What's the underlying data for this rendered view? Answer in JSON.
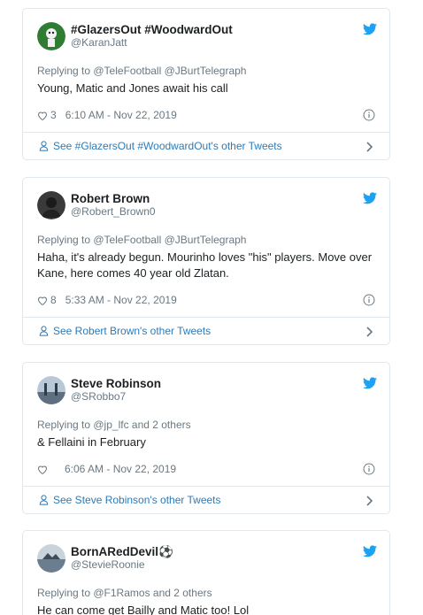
{
  "tweets": [
    {
      "name": "#GlazersOut #WoodwardOut",
      "handle": "@KaranJatt",
      "reply": "Replying to @TeleFootball @JBurtTelegraph",
      "text": "Young, Matic and Jones await his call",
      "likes": "3",
      "time": "6:10 AM - Nov 22, 2019",
      "see": "See #GlazersOut #WoodwardOut's other Tweets",
      "avatar_color": "#2e7d32"
    },
    {
      "name": "Robert Brown",
      "handle": "@Robert_Brown0",
      "reply": "Replying to @TeleFootball @JBurtTelegraph",
      "text": "Haha, it's already begun. Mourinho loves \"his\" players. Move over Kane, here comes 40 year old Zlatan.",
      "likes": "8",
      "time": "5:33 AM - Nov 22, 2019",
      "see": "See Robert Brown's other Tweets",
      "avatar_color": "#3a3a3a"
    },
    {
      "name": "Steve Robinson",
      "handle": "@SRobbo7",
      "reply": "Replying to @jp_lfc and 2 others",
      "text": "& Fellaini in February",
      "likes": "",
      "time": "6:06 AM - Nov 22, 2019",
      "see": "See Steve Robinson's other Tweets",
      "avatar_color": "#8aa2b8"
    },
    {
      "name": "BornARedDevil⚽",
      "handle": "@StevieRoonie",
      "reply": "Replying to @F1Ramos and 2 others",
      "text": "He can come get Bailly and Matic too! Lol",
      "avatar_color": "#6b7d8f"
    }
  ],
  "colors": {
    "link": "#2b7bb9",
    "twitter": "#1da1f2",
    "muted": "#697882",
    "border": "#e1e8ed"
  },
  "icons": [
    "twitter-bird-icon",
    "heart-icon",
    "info-icon",
    "person-icon",
    "chevron-right-icon"
  ]
}
